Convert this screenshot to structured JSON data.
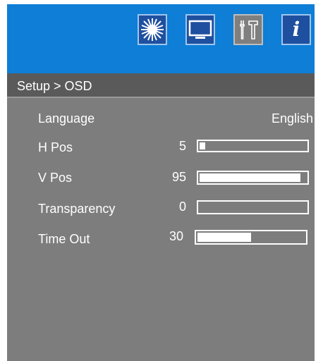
{
  "toolbar": {
    "icons": [
      {
        "name": "brightness-icon",
        "active": false
      },
      {
        "name": "monitor-icon",
        "active": false
      },
      {
        "name": "tools-icon",
        "active": true
      },
      {
        "name": "info-icon",
        "active": false
      }
    ],
    "info_glyph": "i"
  },
  "breadcrumb": "Setup > OSD",
  "settings": {
    "language": {
      "label": "Language",
      "value": "English"
    },
    "h_pos": {
      "label": "H Pos",
      "value": "5",
      "level": 0.05
    },
    "v_pos": {
      "label": "V Pos",
      "value": "95",
      "level": 0.95
    },
    "transparency": {
      "label": "Transparency",
      "value": "0",
      "level": 0.0
    },
    "time_out": {
      "label": "Time Out",
      "value": "30",
      "level": 0.5
    }
  },
  "colors": {
    "header_blue": "#0e7ed6",
    "panel_gray": "#7d7d7d",
    "breadcrumb_gray": "#5a5a5a"
  }
}
